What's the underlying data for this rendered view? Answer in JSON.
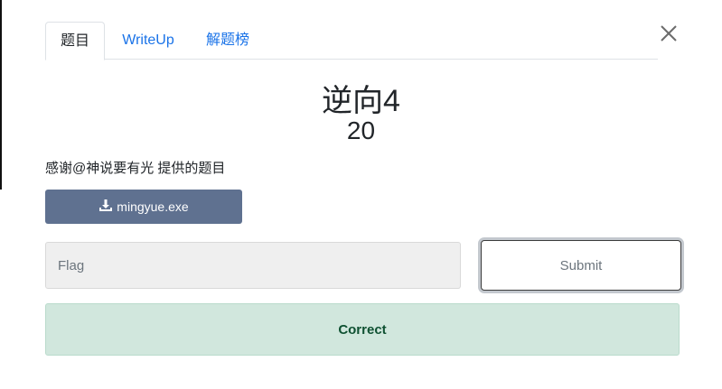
{
  "tabs": [
    {
      "label": "题目",
      "active": true
    },
    {
      "label": "WriteUp",
      "active": false
    },
    {
      "label": "解题榜",
      "active": false
    }
  ],
  "close_icon": "close-icon",
  "challenge": {
    "title": "逆向4",
    "points": "20",
    "description": "感谢@神说要有光 提供的题目"
  },
  "file": {
    "icon": "download-icon",
    "label": "mingyue.exe"
  },
  "flag_input": {
    "placeholder": "Flag",
    "value": ""
  },
  "submit": {
    "label": "Submit"
  },
  "result": {
    "message": "Correct"
  },
  "colors": {
    "tab_link": "#1a73e8",
    "file_button": "#5f7190",
    "success_bg": "#d1e7dd",
    "success_text": "#0f5132"
  }
}
